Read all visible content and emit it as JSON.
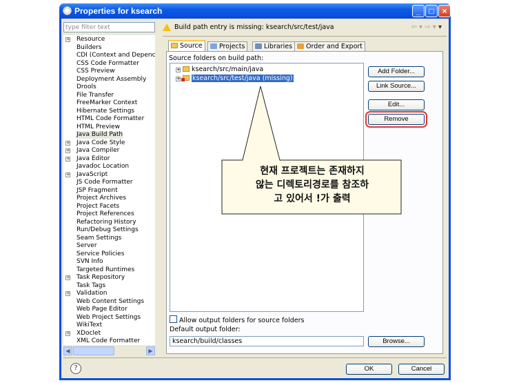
{
  "window": {
    "title": "Properties for ksearch"
  },
  "filter": {
    "placeholder": "type filter text"
  },
  "tree": [
    {
      "label": "Resource",
      "expandable": true
    },
    {
      "label": "Builders"
    },
    {
      "label": "CDI (Context and Depenc"
    },
    {
      "label": "CSS Code Formatter"
    },
    {
      "label": "CSS Preview"
    },
    {
      "label": "Deployment Assembly"
    },
    {
      "label": "Drools"
    },
    {
      "label": "File Transfer"
    },
    {
      "label": "FreeMarker Context"
    },
    {
      "label": "Hibernate Settings"
    },
    {
      "label": "HTML Code Formatter"
    },
    {
      "label": "HTML Preview"
    },
    {
      "label": "Java Build Path",
      "selected": true
    },
    {
      "label": "Java Code Style",
      "expandable": true
    },
    {
      "label": "Java Compiler",
      "expandable": true
    },
    {
      "label": "Java Editor",
      "expandable": true
    },
    {
      "label": "Javadoc Location"
    },
    {
      "label": "JavaScript",
      "expandable": true
    },
    {
      "label": "JS Code Formatter"
    },
    {
      "label": "JSP Fragment"
    },
    {
      "label": "Project Archives"
    },
    {
      "label": "Project Facets"
    },
    {
      "label": "Project References"
    },
    {
      "label": "Refactoring History"
    },
    {
      "label": "Run/Debug Settings"
    },
    {
      "label": "Seam Settings"
    },
    {
      "label": "Server"
    },
    {
      "label": "Service Policies"
    },
    {
      "label": "SVN Info"
    },
    {
      "label": "Targeted Runtimes"
    },
    {
      "label": "Task Repository",
      "expandable": true
    },
    {
      "label": "Task Tags"
    },
    {
      "label": "Validation",
      "expandable": true
    },
    {
      "label": "Web Content Settings"
    },
    {
      "label": "Web Page Editor"
    },
    {
      "label": "Web Project Settings"
    },
    {
      "label": "WikiText"
    },
    {
      "label": "XDoclet",
      "expandable": true
    },
    {
      "label": "XML Code Formatter"
    }
  ],
  "warning": {
    "text": "Build path entry is missing: ksearch/src/test/java"
  },
  "tabs": [
    {
      "label": "Source",
      "icon": "source-folder-icon",
      "active": true
    },
    {
      "label": "Projects",
      "icon": "projects-icon"
    },
    {
      "label": "Libraries",
      "icon": "libraries-icon"
    },
    {
      "label": "Order and Export",
      "icon": "order-export-icon"
    }
  ],
  "source": {
    "label": "Source folders on build path:",
    "items": [
      {
        "label": "ksearch/src/main/java",
        "missing": false,
        "selected": false
      },
      {
        "label": "ksearch/src/test/java (missing)",
        "missing": true,
        "selected": true
      }
    ]
  },
  "buttons": {
    "add_folder": "Add Folder...",
    "link_source": "Link Source...",
    "edit": "Edit...",
    "remove": "Remove",
    "browse": "Browse...",
    "ok": "OK",
    "cancel": "Cancel"
  },
  "output": {
    "allow_label": "Allow output folders for source folders",
    "default_label": "Default output folder:",
    "default_value": "ksearch/build/classes"
  },
  "callout": {
    "line1": "현재 프로젝트는 존재하지",
    "line2": "않는 디렉토리경로를 참조하",
    "line3": "고 있어서 !가 출력"
  },
  "colors": {
    "titlebar": "#0b5be6",
    "highlight": "#e23333",
    "selection": "#316ac5"
  }
}
